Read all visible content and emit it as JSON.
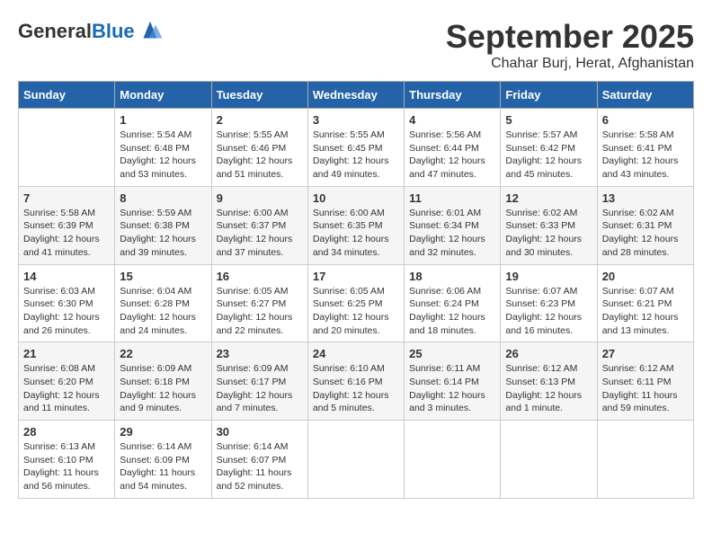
{
  "header": {
    "logo_general": "General",
    "logo_blue": "Blue",
    "month_title": "September 2025",
    "location": "Chahar Burj, Herat, Afghanistan"
  },
  "days_of_week": [
    "Sunday",
    "Monday",
    "Tuesday",
    "Wednesday",
    "Thursday",
    "Friday",
    "Saturday"
  ],
  "weeks": [
    [
      {
        "day": "",
        "info": ""
      },
      {
        "day": "1",
        "info": "Sunrise: 5:54 AM\nSunset: 6:48 PM\nDaylight: 12 hours\nand 53 minutes."
      },
      {
        "day": "2",
        "info": "Sunrise: 5:55 AM\nSunset: 6:46 PM\nDaylight: 12 hours\nand 51 minutes."
      },
      {
        "day": "3",
        "info": "Sunrise: 5:55 AM\nSunset: 6:45 PM\nDaylight: 12 hours\nand 49 minutes."
      },
      {
        "day": "4",
        "info": "Sunrise: 5:56 AM\nSunset: 6:44 PM\nDaylight: 12 hours\nand 47 minutes."
      },
      {
        "day": "5",
        "info": "Sunrise: 5:57 AM\nSunset: 6:42 PM\nDaylight: 12 hours\nand 45 minutes."
      },
      {
        "day": "6",
        "info": "Sunrise: 5:58 AM\nSunset: 6:41 PM\nDaylight: 12 hours\nand 43 minutes."
      }
    ],
    [
      {
        "day": "7",
        "info": "Sunrise: 5:58 AM\nSunset: 6:39 PM\nDaylight: 12 hours\nand 41 minutes."
      },
      {
        "day": "8",
        "info": "Sunrise: 5:59 AM\nSunset: 6:38 PM\nDaylight: 12 hours\nand 39 minutes."
      },
      {
        "day": "9",
        "info": "Sunrise: 6:00 AM\nSunset: 6:37 PM\nDaylight: 12 hours\nand 37 minutes."
      },
      {
        "day": "10",
        "info": "Sunrise: 6:00 AM\nSunset: 6:35 PM\nDaylight: 12 hours\nand 34 minutes."
      },
      {
        "day": "11",
        "info": "Sunrise: 6:01 AM\nSunset: 6:34 PM\nDaylight: 12 hours\nand 32 minutes."
      },
      {
        "day": "12",
        "info": "Sunrise: 6:02 AM\nSunset: 6:33 PM\nDaylight: 12 hours\nand 30 minutes."
      },
      {
        "day": "13",
        "info": "Sunrise: 6:02 AM\nSunset: 6:31 PM\nDaylight: 12 hours\nand 28 minutes."
      }
    ],
    [
      {
        "day": "14",
        "info": "Sunrise: 6:03 AM\nSunset: 6:30 PM\nDaylight: 12 hours\nand 26 minutes."
      },
      {
        "day": "15",
        "info": "Sunrise: 6:04 AM\nSunset: 6:28 PM\nDaylight: 12 hours\nand 24 minutes."
      },
      {
        "day": "16",
        "info": "Sunrise: 6:05 AM\nSunset: 6:27 PM\nDaylight: 12 hours\nand 22 minutes."
      },
      {
        "day": "17",
        "info": "Sunrise: 6:05 AM\nSunset: 6:25 PM\nDaylight: 12 hours\nand 20 minutes."
      },
      {
        "day": "18",
        "info": "Sunrise: 6:06 AM\nSunset: 6:24 PM\nDaylight: 12 hours\nand 18 minutes."
      },
      {
        "day": "19",
        "info": "Sunrise: 6:07 AM\nSunset: 6:23 PM\nDaylight: 12 hours\nand 16 minutes."
      },
      {
        "day": "20",
        "info": "Sunrise: 6:07 AM\nSunset: 6:21 PM\nDaylight: 12 hours\nand 13 minutes."
      }
    ],
    [
      {
        "day": "21",
        "info": "Sunrise: 6:08 AM\nSunset: 6:20 PM\nDaylight: 12 hours\nand 11 minutes."
      },
      {
        "day": "22",
        "info": "Sunrise: 6:09 AM\nSunset: 6:18 PM\nDaylight: 12 hours\nand 9 minutes."
      },
      {
        "day": "23",
        "info": "Sunrise: 6:09 AM\nSunset: 6:17 PM\nDaylight: 12 hours\nand 7 minutes."
      },
      {
        "day": "24",
        "info": "Sunrise: 6:10 AM\nSunset: 6:16 PM\nDaylight: 12 hours\nand 5 minutes."
      },
      {
        "day": "25",
        "info": "Sunrise: 6:11 AM\nSunset: 6:14 PM\nDaylight: 12 hours\nand 3 minutes."
      },
      {
        "day": "26",
        "info": "Sunrise: 6:12 AM\nSunset: 6:13 PM\nDaylight: 12 hours\nand 1 minute."
      },
      {
        "day": "27",
        "info": "Sunrise: 6:12 AM\nSunset: 6:11 PM\nDaylight: 11 hours\nand 59 minutes."
      }
    ],
    [
      {
        "day": "28",
        "info": "Sunrise: 6:13 AM\nSunset: 6:10 PM\nDaylight: 11 hours\nand 56 minutes."
      },
      {
        "day": "29",
        "info": "Sunrise: 6:14 AM\nSunset: 6:09 PM\nDaylight: 11 hours\nand 54 minutes."
      },
      {
        "day": "30",
        "info": "Sunrise: 6:14 AM\nSunset: 6:07 PM\nDaylight: 11 hours\nand 52 minutes."
      },
      {
        "day": "",
        "info": ""
      },
      {
        "day": "",
        "info": ""
      },
      {
        "day": "",
        "info": ""
      },
      {
        "day": "",
        "info": ""
      }
    ]
  ]
}
